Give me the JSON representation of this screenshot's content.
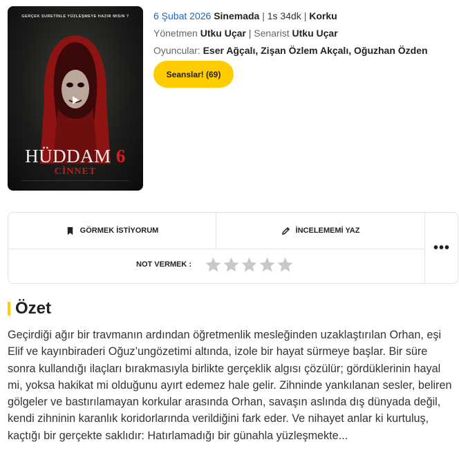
{
  "poster": {
    "tagline": "GERÇEK SURETİNLE YÜZLEŞMEYE HAZIR MISIN ?",
    "title_main": "HÜDDAM",
    "title_num": "6",
    "title_sub": "CİNNET"
  },
  "info": {
    "date": "6 Şubat 2026",
    "status": "Sinemada",
    "duration": "1s 34dk",
    "genre": "Korku",
    "director_label": "Yönetmen",
    "director": "Utku Uçar",
    "writer_label": "Senarist",
    "writer": "Utku Uçar",
    "cast_label": "Oyuncular:",
    "cast": [
      "Eser Ağçalı",
      "Zişan Özlem Akçalı",
      "Oğuzhan Özden"
    ],
    "sep": "|"
  },
  "seans_button": "Seanslar! (69)",
  "actions": {
    "watchlist": "GÖRMEK İSTİYORUM",
    "review": "İNCELEMEMİ YAZ",
    "more": "•••",
    "rate_label": "NOT VERMEK :",
    "rating": 0,
    "max_rating": 5
  },
  "summary": {
    "title": "Özet",
    "text": "Geçirdiği ağır bir travmanın ardından öğretmenlik mesleğinden uzaklaştırılan Orhan, eşi Elif ve kayınbiraderi Oğuz’ungözetimi altında, izole bir hayat sürmeye başlar. Bir süre sonra kullandığı ilaçları bırakmasıyla birlikte gerçeklik algısı çözülür; gördüklerinin hayal mi, yoksa hakikat mi olduğunu ayırt edemez hale gelir. Zihninde yankılanan sesler, beliren gölgeler ve bastırılamayan korkular arasında Orhan, savaşın aslında dış dünyada değil, kendi zihninin karanlık koridorlarında verildiğini fark eder. Ve nihayet anlar ki kurtuluş, kaçtığı bir gerçekte saklıdır: Hatırlamadığı bir günahla yüzleşmekte..."
  },
  "colors": {
    "accent": "#ffcc00",
    "link": "#1565c0",
    "star_empty": "#c8c8c8"
  }
}
